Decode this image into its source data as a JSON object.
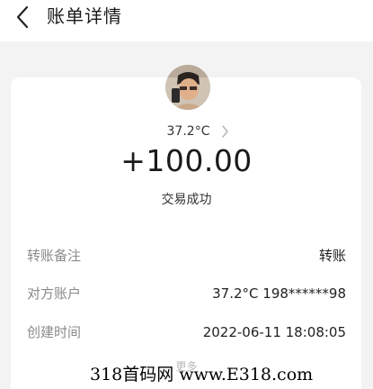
{
  "header": {
    "title": "账单详情",
    "back_icon": "chevron-left-icon"
  },
  "payee": {
    "name": "37.2°C",
    "chevron_icon": "chevron-right-icon"
  },
  "amount": "+100.00",
  "status": "交易成功",
  "details": [
    {
      "label": "转账备注",
      "value": "转账"
    },
    {
      "label": "对方账户",
      "value": "37.2°C 198******98"
    },
    {
      "label": "创建时间",
      "value": "2022-06-11 18:08:05"
    }
  ],
  "more_label": "更多",
  "watermark": "318首码网 www.E318.com",
  "colors": {
    "page_bg": "#f3f3f3",
    "card_bg": "#ffffff",
    "label_gray": "#8a8a8a"
  }
}
